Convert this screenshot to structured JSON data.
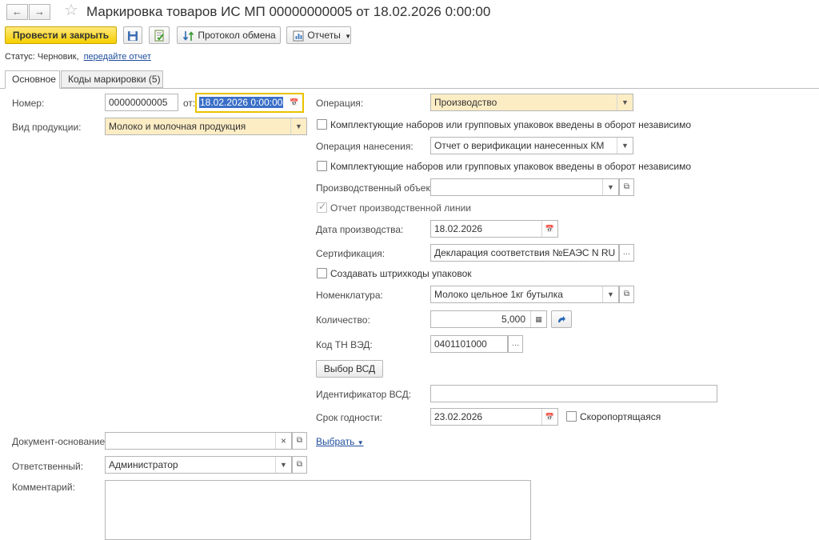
{
  "window": {
    "title": "Маркировка товаров ИС МП 00000000005 от 18.02.2026 0:00:00",
    "back_icon": "arrow-left-icon",
    "forward_icon": "arrow-right-icon",
    "favorite_icon": "star-icon"
  },
  "toolbar": {
    "post_close_label": "Провести и закрыть",
    "save_icon": "floppy-disk-icon",
    "post_icon": "post-document-icon",
    "exchange_label": "Протокол обмена",
    "reports_label": "Отчеты"
  },
  "status": {
    "prefix": "Статус:",
    "value": "Черновик,",
    "link": "передайте отчет"
  },
  "tabs": [
    {
      "label": "Основное",
      "active": true
    },
    {
      "label": "Коды маркировки (5)",
      "active": false
    }
  ],
  "left": {
    "number_label": "Номер:",
    "number_value": "00000000005",
    "date_from_label": "от:",
    "date_value": "18.02.2026  0:00:00",
    "product_type_label": "Вид продукции:",
    "product_type_value": "Молоко и молочная продукция",
    "base_doc_label": "Документ-основание:",
    "base_doc_value": "",
    "choose_link": "Выбрать",
    "responsible_label": "Ответственный:",
    "responsible_value": "Администратор",
    "comment_label": "Комментарий:",
    "comment_value": ""
  },
  "right": {
    "operation_label": "Операция:",
    "operation_value": "Производство",
    "components_check_1": "Комплектующие наборов или групповых упаковок введены в оборот независимо",
    "application_label": "Операция нанесения:",
    "application_value": "Отчет о верификации нанесенных КМ",
    "components_check_2": "Комплектующие наборов или групповых упаковок введены в оборот независимо",
    "prod_object_label": "Производственный объект:",
    "prod_object_value": "",
    "line_report_check": "Отчет производственной линии",
    "prod_date_label": "Дата производства:",
    "prod_date_value": "18.02.2026",
    "cert_label": "Сертификация:",
    "cert_value": "Декларация соответствия №ЕАЭС N RU Д-",
    "barcodes_check": "Создавать штрихкоды упаковок",
    "nomenclature_label": "Номенклатура:",
    "nomenclature_value": "Молоко цельное 1кг бутылка",
    "quantity_label": "Количество:",
    "quantity_value": "5,000",
    "tnved_label": "Код ТН ВЭД:",
    "tnved_value": "0401101000",
    "vsd_button": "Выбор ВСД",
    "vsd_id_label": "Идентификатор ВСД:",
    "vsd_id_value": "",
    "expiry_label": "Срок годности:",
    "expiry_value": "23.02.2026",
    "perishable_check": "Скоропортящаяся"
  }
}
